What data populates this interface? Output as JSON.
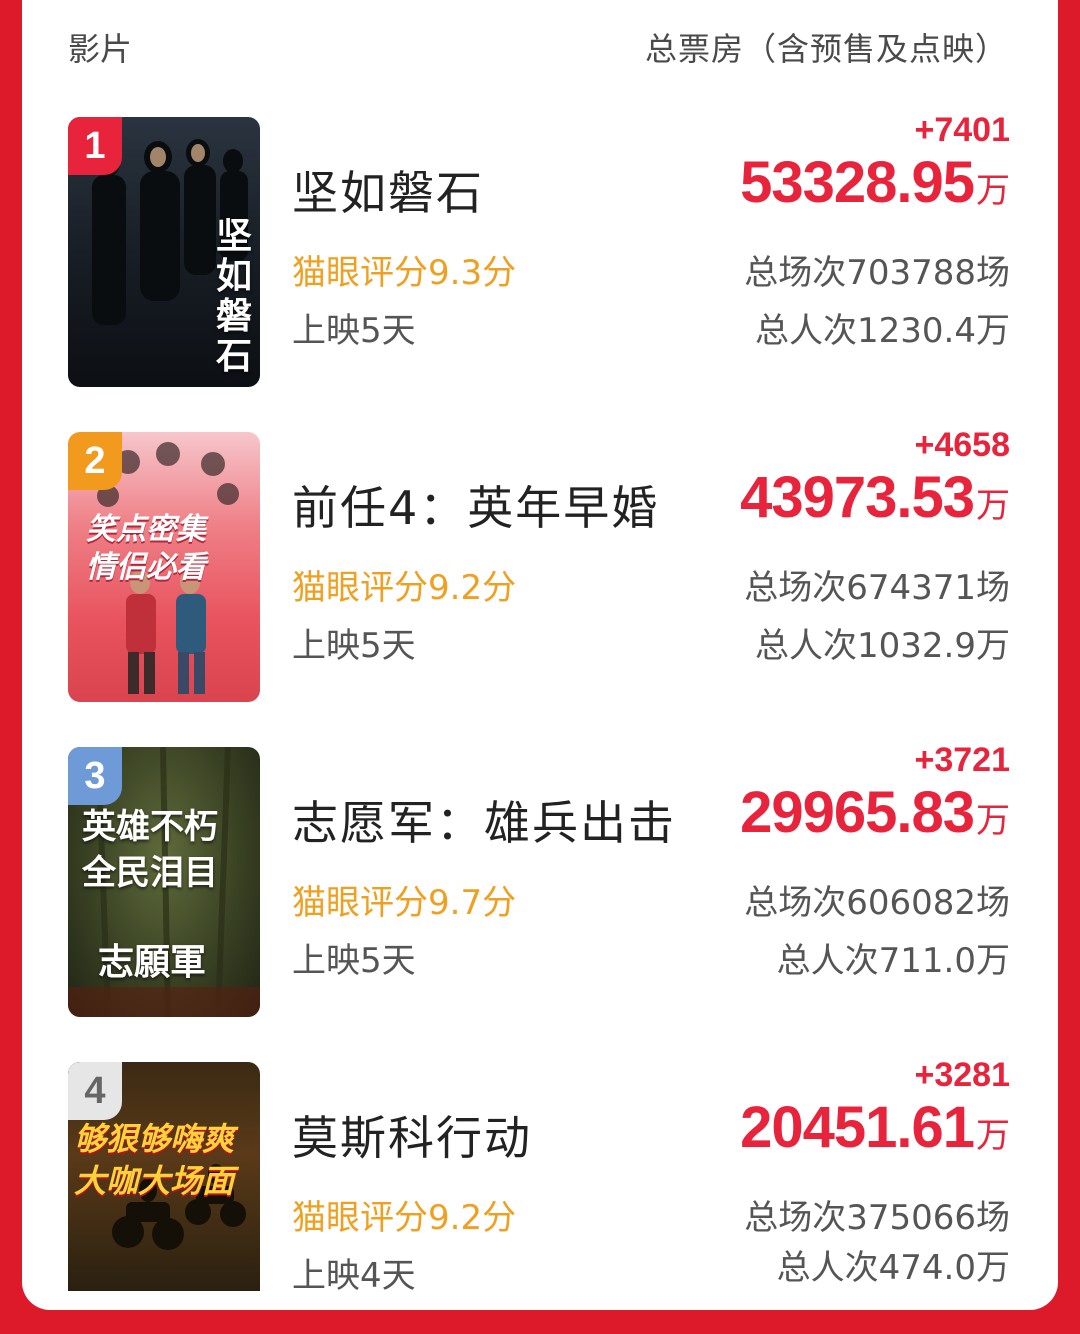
{
  "header": {
    "left_label": "影片",
    "right_label": "总票房（含预售及点映）"
  },
  "movies": [
    {
      "rank": "1",
      "title": "坚如磐石",
      "rating": "猫眼评分9.3分",
      "days": "上映5天",
      "delta": "+7401",
      "boxoffice": "53328.95",
      "unit": "万",
      "shows": "总场次703788场",
      "viewers": "总人次1230.4万",
      "badge_color": "#e8243c",
      "poster_text": [
        "坚",
        "如",
        "磐",
        "石"
      ]
    },
    {
      "rank": "2",
      "title": "前任4：英年早婚",
      "rating": "猫眼评分9.2分",
      "days": "上映5天",
      "delta": "+4658",
      "boxoffice": "43973.53",
      "unit": "万",
      "shows": "总场次674371场",
      "viewers": "总人次1032.9万",
      "badge_color": "#f29a1d",
      "poster_text": [
        "笑点密集",
        "情侣必看"
      ]
    },
    {
      "rank": "3",
      "title": "志愿军：雄兵出击",
      "rating": "猫眼评分9.7分",
      "days": "上映5天",
      "delta": "+3721",
      "boxoffice": "29965.83",
      "unit": "万",
      "shows": "总场次606082场",
      "viewers": "总人次711.0万",
      "badge_color": "#6f9ad8",
      "poster_text": [
        "英雄不朽",
        "全民泪目",
        "志願軍"
      ]
    },
    {
      "rank": "4",
      "title": "莫斯科行动",
      "rating": "猫眼评分9.2分",
      "days": "上映4天",
      "delta": "+3281",
      "boxoffice": "20451.61",
      "unit": "万",
      "shows": "总场次375066场",
      "viewers": "总人次474.0万",
      "badge_color": "#8f8f8f",
      "poster_text": [
        "够狠够嗨爽",
        "大咖大场面"
      ]
    }
  ]
}
